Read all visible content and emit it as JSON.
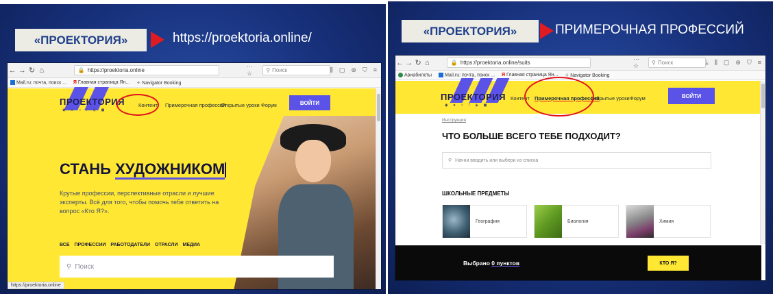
{
  "left": {
    "label": "«ПРОЕКТОРИЯ»",
    "caption": "https://proektoria.online/",
    "browser": {
      "url": "https://proektoria.online",
      "search_placeholder": "Поиск",
      "bookmarks": [
        "Mail.ru: почта, поиск ...",
        "Главная страница Ян...",
        "Navigator Booking"
      ]
    },
    "site": {
      "logo": "ПРОЕКТОРИЯ",
      "menu": [
        "Контент",
        "Примерочная профессий",
        "Открытые уроки",
        "Форум"
      ],
      "login": "ВОЙТИ",
      "headline_prefix": "СТАНЬ ",
      "headline_word": "ХУДОЖНИКОМ",
      "description": "Крутые профессии, перспективные отрасли и лучшие эксперты. Всё для того, чтобы помочь тебе ответить на вопрос «Кто Я?».",
      "categories": [
        "ВСЕ",
        "ПРОФЕССИИ",
        "РАБОТОДАТЕЛИ",
        "ОТРАСЛИ",
        "МЕДИА"
      ],
      "search_placeholder": "Поиск",
      "status_url": "https://proektoria.online"
    }
  },
  "right": {
    "label": "«ПРОЕКТОРИЯ»",
    "caption": "ПРИМЕРОЧНАЯ ПРОФЕССИЙ",
    "browser": {
      "url": "https://proektoria.online/suits",
      "search_placeholder": "Поиск",
      "bookmarks": [
        "Авиабилеты",
        "Mail.ru: почта, поиск ...",
        "Главная страница Ян...",
        "Navigator Booking"
      ]
    },
    "site": {
      "logo": "ПРОЕКТОРИЯ",
      "menu": [
        "Контент",
        "Примерочная профессий",
        "Открытые уроки",
        "Форум"
      ],
      "login": "ВОЙТИ",
      "breadcrumb": "Инструкция",
      "heading": "ЧТО БОЛЬШЕ ВСЕГО ТЕБЕ ПОДХОДИТ?",
      "search_placeholder": "Начни вводить или выбери из списка",
      "section_title": "ШКОЛЬНЫЕ ПРЕДМЕТЫ",
      "subjects": [
        "География",
        "Биология",
        "Химия"
      ],
      "selected_prefix": "Выбрано ",
      "selected_count": "0 пунктов",
      "who_button": "КТО Я?"
    }
  },
  "colors": {
    "slide_bg": "#17307a",
    "site_yellow": "#ffe733",
    "accent_purple": "#5b53e8",
    "annotation_red": "#e0121b"
  }
}
